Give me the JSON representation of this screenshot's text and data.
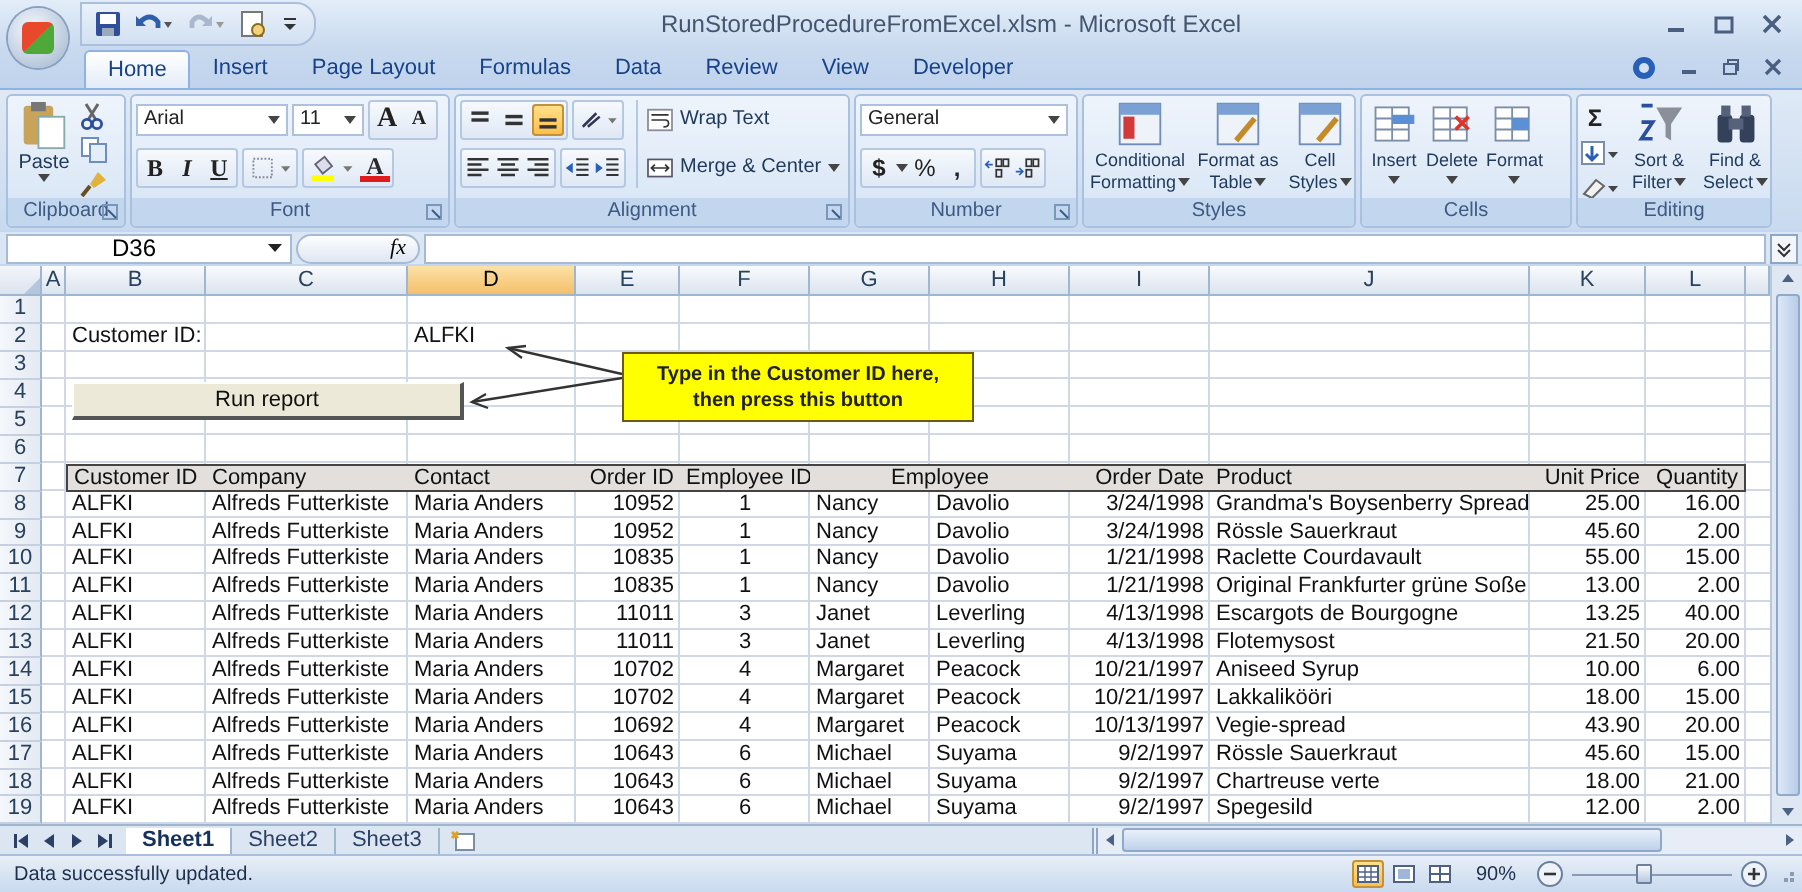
{
  "window": {
    "title": "RunStoredProcedureFromExcel.xlsm - Microsoft Excel"
  },
  "tabs": [
    {
      "label": "Home",
      "selected": true
    },
    {
      "label": "Insert",
      "selected": false
    },
    {
      "label": "Page Layout",
      "selected": false
    },
    {
      "label": "Formulas",
      "selected": false
    },
    {
      "label": "Data",
      "selected": false
    },
    {
      "label": "Review",
      "selected": false
    },
    {
      "label": "View",
      "selected": false
    },
    {
      "label": "Developer",
      "selected": false
    }
  ],
  "ribbon": {
    "clipboard": {
      "paste": "Paste",
      "label": "Clipboard"
    },
    "font": {
      "name": "Arial",
      "size": "11",
      "grow": "A",
      "shrink": "A",
      "bold": "B",
      "italic": "I",
      "underline": "U",
      "font_color_button": "A",
      "label": "Font"
    },
    "alignment": {
      "vertical": [
        {
          "selected": false
        },
        {
          "selected": false
        },
        {
          "selected": true
        }
      ],
      "wrap": "Wrap Text",
      "merge": "Merge & Center",
      "label": "Alignment"
    },
    "number": {
      "format": "General",
      "currency": "$",
      "percent": "%",
      "comma": ",",
      "label": "Number"
    },
    "styles": {
      "buttons": [
        "Conditional Formatting",
        "Format as Table",
        "Cell Styles"
      ],
      "label": "Styles"
    },
    "cells": {
      "buttons": [
        "Insert",
        "Delete",
        "Format"
      ],
      "label": "Cells"
    },
    "editing": {
      "sum": "Σ",
      "sort": "Sort & Filter",
      "find": "Find & Select",
      "label": "Editing"
    }
  },
  "formula_bar": {
    "name_box": "D36",
    "fx": "fx"
  },
  "sheet": {
    "columns": [
      {
        "label": "A",
        "selected": false
      },
      {
        "label": "B",
        "selected": false
      },
      {
        "label": "C",
        "selected": false
      },
      {
        "label": "D",
        "selected": true
      },
      {
        "label": "E",
        "selected": false
      },
      {
        "label": "F",
        "selected": false
      },
      {
        "label": "G",
        "selected": false
      },
      {
        "label": "H",
        "selected": false
      },
      {
        "label": "I",
        "selected": false
      },
      {
        "label": "J",
        "selected": false
      },
      {
        "label": "K",
        "selected": false
      },
      {
        "label": "L",
        "selected": false
      }
    ],
    "rows": [
      "1",
      "2",
      "3",
      "4",
      "5",
      "6",
      "7",
      "8",
      "9",
      "10",
      "11",
      "12",
      "13",
      "14",
      "15",
      "16",
      "17",
      "18",
      "19"
    ],
    "customer_label": "Customer ID:",
    "customer_id": "ALFKI",
    "run_button": "Run report",
    "callout": "Type in  the Customer ID here,\nthen press this button",
    "table": {
      "columns": [
        "Customer ID",
        "Company",
        "Contact",
        "Order ID",
        "Employee ID",
        "Employee",
        "",
        "Order Date",
        "Product",
        "Unit Price",
        "Quantity"
      ],
      "rows": [
        [
          "ALFKI",
          "Alfreds Futterkiste",
          "Maria Anders",
          "10952",
          "1",
          "Nancy",
          "Davolio",
          "3/24/1998",
          "Grandma's Boysenberry Spread",
          "25.00",
          "16.00"
        ],
        [
          "ALFKI",
          "Alfreds Futterkiste",
          "Maria Anders",
          "10952",
          "1",
          "Nancy",
          "Davolio",
          "3/24/1998",
          "Rössle Sauerkraut",
          "45.60",
          "2.00"
        ],
        [
          "ALFKI",
          "Alfreds Futterkiste",
          "Maria Anders",
          "10835",
          "1",
          "Nancy",
          "Davolio",
          "1/21/1998",
          "Raclette Courdavault",
          "55.00",
          "15.00"
        ],
        [
          "ALFKI",
          "Alfreds Futterkiste",
          "Maria Anders",
          "10835",
          "1",
          "Nancy",
          "Davolio",
          "1/21/1998",
          "Original Frankfurter grüne Soße",
          "13.00",
          "2.00"
        ],
        [
          "ALFKI",
          "Alfreds Futterkiste",
          "Maria Anders",
          "11011",
          "3",
          "Janet",
          "Leverling",
          "4/13/1998",
          "Escargots de Bourgogne",
          "13.25",
          "40.00"
        ],
        [
          "ALFKI",
          "Alfreds Futterkiste",
          "Maria Anders",
          "11011",
          "3",
          "Janet",
          "Leverling",
          "4/13/1998",
          "Flotemysost",
          "21.50",
          "20.00"
        ],
        [
          "ALFKI",
          "Alfreds Futterkiste",
          "Maria Anders",
          "10702",
          "4",
          "Margaret",
          "Peacock",
          "10/21/1997",
          "Aniseed Syrup",
          "10.00",
          "6.00"
        ],
        [
          "ALFKI",
          "Alfreds Futterkiste",
          "Maria Anders",
          "10702",
          "4",
          "Margaret",
          "Peacock",
          "10/21/1997",
          "Lakkalikööri",
          "18.00",
          "15.00"
        ],
        [
          "ALFKI",
          "Alfreds Futterkiste",
          "Maria Anders",
          "10692",
          "4",
          "Margaret",
          "Peacock",
          "10/13/1997",
          "Vegie-spread",
          "43.90",
          "20.00"
        ],
        [
          "ALFKI",
          "Alfreds Futterkiste",
          "Maria Anders",
          "10643",
          "6",
          "Michael",
          "Suyama",
          "9/2/1997",
          "Rössle Sauerkraut",
          "45.60",
          "15.00"
        ],
        [
          "ALFKI",
          "Alfreds Futterkiste",
          "Maria Anders",
          "10643",
          "6",
          "Michael",
          "Suyama",
          "9/2/1997",
          "Chartreuse verte",
          "18.00",
          "21.00"
        ],
        [
          "ALFKI",
          "Alfreds Futterkiste",
          "Maria Anders",
          "10643",
          "6",
          "Michael",
          "Suyama",
          "9/2/1997",
          "Spegesild",
          "12.00",
          "2.00"
        ]
      ]
    }
  },
  "sheet_tabs": [
    {
      "label": "Sheet1",
      "selected": true
    },
    {
      "label": "Sheet2",
      "selected": false
    },
    {
      "label": "Sheet3",
      "selected": false
    }
  ],
  "status_bar": {
    "message": "Data successfully updated.",
    "views": [
      {
        "selected": true
      },
      {
        "selected": false
      },
      {
        "selected": false
      }
    ],
    "zoom": "90%",
    "zoom_slider": {
      "level": 0.45
    }
  }
}
